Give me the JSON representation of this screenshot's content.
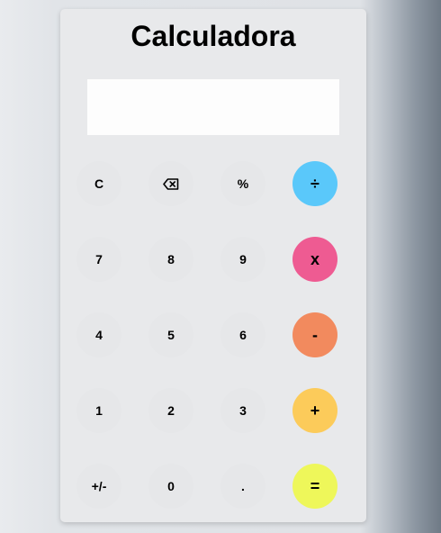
{
  "app": {
    "title": "Calculadora"
  },
  "display": {
    "value": ""
  },
  "colors": {
    "divide": "#5ac8fa",
    "multiply": "#ee5b92",
    "minus": "#f28a5e",
    "plus": "#fccb5a",
    "equals": "#eef75a"
  },
  "keys": {
    "clear": "C",
    "backspace_icon": "backspace-icon",
    "percent": "%",
    "divide": "÷",
    "seven": "7",
    "eight": "8",
    "nine": "9",
    "multiply": "x",
    "four": "4",
    "five": "5",
    "six": "6",
    "minus": "-",
    "one": "1",
    "two": "2",
    "three": "3",
    "plus": "+",
    "sign": "+/-",
    "zero": "0",
    "decimal": ".",
    "equals": "="
  }
}
